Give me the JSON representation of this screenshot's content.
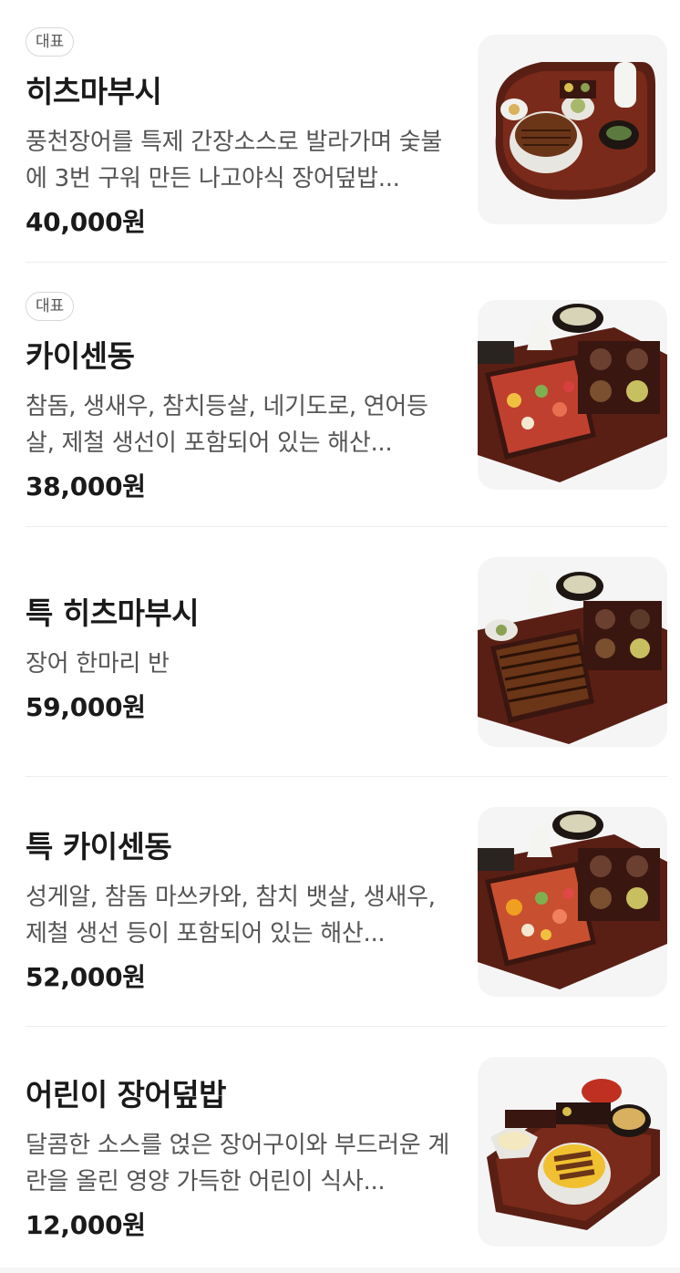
{
  "menu": {
    "items": [
      {
        "badge": "대표",
        "name": "히츠마부시",
        "description": "풍천장어를 특제 간장소스로 발라가며 숯불에 3번 구워 만든 나고야식 장어덮밥...",
        "price": "40,000원",
        "image_icon": "hitsumabushi-food-image"
      },
      {
        "badge": "대표",
        "name": "카이센동",
        "description": "참돔, 생새우, 참치등살, 네기도로, 연어등살, 제철 생선이 포함되어 있는 해산...",
        "price": "38,000원",
        "image_icon": "kaisendon-food-image"
      },
      {
        "badge": "",
        "name": "특 히츠마부시",
        "description": "장어 한마리 반",
        "price": "59,000원",
        "image_icon": "special-hitsumabushi-food-image"
      },
      {
        "badge": "",
        "name": "특 카이센동",
        "description": "성게알, 참돔 마쓰카와, 참치 뱃살, 생새우, 제철 생선 등이 포함되어 있는 해산...",
        "price": "52,000원",
        "image_icon": "special-kaisendon-food-image"
      },
      {
        "badge": "",
        "name": "어린이 장어덮밥",
        "description": "달콤한 소스를 얹은 장어구이와 부드러운 계란을 올린 영양 가득한 어린이 식사...",
        "price": "12,000원",
        "image_icon": "kids-eel-rice-food-image"
      }
    ]
  },
  "colors": {
    "tray": "#5a1f14",
    "eel": "#6b3518",
    "thumb_bg": "#f5f5f5"
  }
}
